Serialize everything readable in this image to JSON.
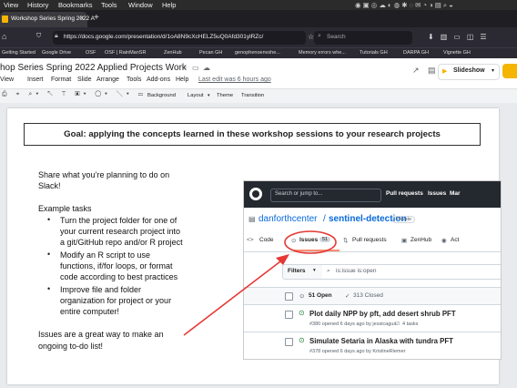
{
  "menubar": {
    "items": [
      "View",
      "History",
      "Bookmarks",
      "Tools",
      "Window",
      "Help"
    ]
  },
  "browser": {
    "tab_title": "Workshop Series Spring 2022 A",
    "url": "https://docs.google.com/presentation/d/1oA8N9cXcHELZ5uQ0Afd301ylRZc/",
    "search_placeholder": "Search",
    "bookmarks": [
      "Getting Started",
      "Google Drive",
      "OSF",
      "OSF | RainManSR",
      "ZenHub",
      "Pecan GH",
      "genophenoenvshe...",
      "Memory errors whe...",
      "Tutorials GH",
      "DARPA GH",
      "Vignette GH"
    ]
  },
  "slides": {
    "doc_title": "hop Series Spring 2022 Applied Projects Work",
    "menus": [
      "View",
      "Insert",
      "Format",
      "Slide",
      "Arrange",
      "Tools",
      "Add-ons",
      "Help"
    ],
    "last_edit": "Last edit was 6 hours ago",
    "slideshow_label": "Slideshow",
    "toolbar": {
      "background": "Background",
      "layout": "Layout",
      "theme": "Theme",
      "transition": "Transition"
    }
  },
  "slide": {
    "goal": "Goal: applying the concepts learned in these workshop sessions to your research projects",
    "share_line1": "Share what you’re planning to do on",
    "share_line2": "Slack!",
    "example_tasks": "Example tasks",
    "bullet1": [
      "Turn the project folder for one of",
      "your current research project into",
      "a git/GitHub repo and/or R project"
    ],
    "bullet2": [
      "Modify an R script to use",
      "functions, if/for loops, or format",
      "code according to best practices"
    ],
    "bullet3": [
      "Improve file and folder",
      "organization for project or your",
      "entire computer!"
    ],
    "issues_line1": "Issues are a great way to make an",
    "issues_line2": "ongoing to-do list!"
  },
  "github": {
    "search_placeholder": "Search or jump to...",
    "nav": [
      "Pull requests",
      "Issues",
      "Mar"
    ],
    "owner": "danforthcenter",
    "repo": "sentinel-detection",
    "visibility": "Private",
    "tabs": {
      "code": "Code",
      "issues": "Issues",
      "issues_count": "51",
      "pulls": "Pull requests",
      "zenhub": "ZenHub",
      "actions": "Act"
    },
    "filters_label": "Filters",
    "filter_query": "is:issue is:open",
    "open_count": "51 Open",
    "closed_count": "313 Closed",
    "issues": [
      {
        "title": "Plot daily NPP by pft, add desert shrub PFT",
        "meta": "#380 opened 6 days ago by jessicagus",
        "tasks": "4 tasks"
      },
      {
        "title": "Simulate Setaria in Alaska with tundra PFT",
        "meta": "#378 opened 6 days ago by KristineRiemer"
      }
    ]
  },
  "colors": {
    "accent_red": "#e53935",
    "gh_green": "#1a7f37",
    "gh_dark": "#24292f",
    "link_blue": "#0969da"
  }
}
